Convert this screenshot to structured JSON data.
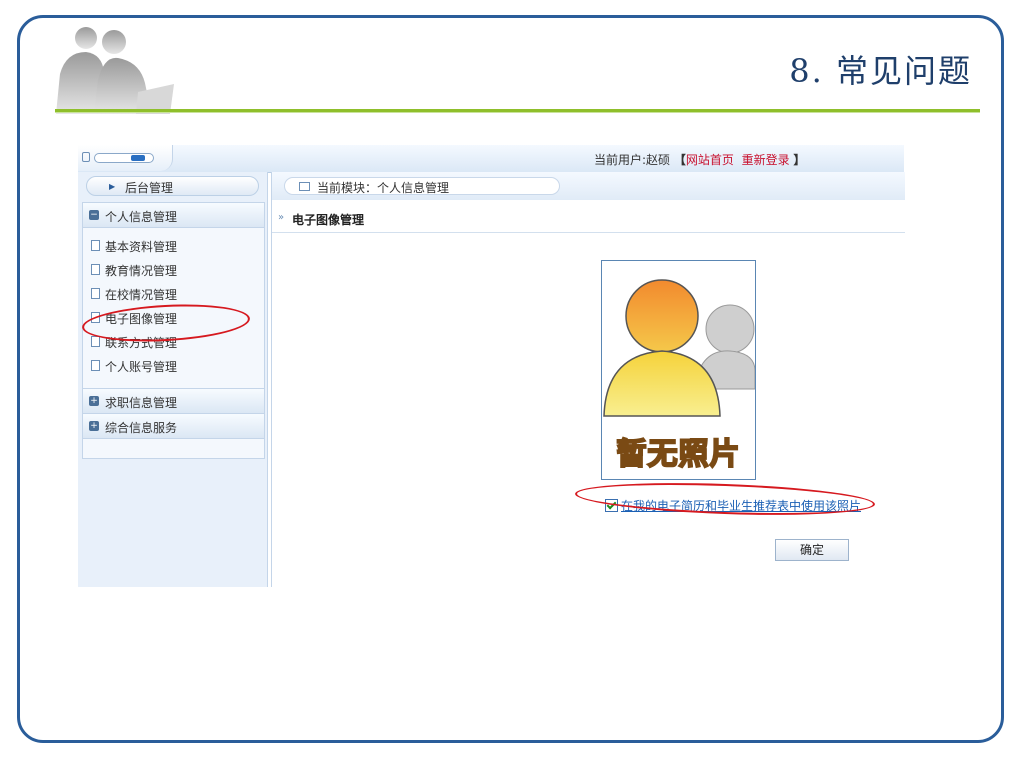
{
  "slide": {
    "title": "8. 常见问题",
    "colors": {
      "frame": "#2a5d9a",
      "rule": "#8fbf2b",
      "highlight": "#d6191f"
    }
  },
  "header": {
    "current_user_label": "当前用户:",
    "user_name": "赵硕",
    "bracket_open": "【",
    "site_home": "网站首页",
    "relogin": "重新登录",
    "bracket_close": "】"
  },
  "sidebar": {
    "header_label": "后台管理",
    "groups": [
      {
        "label": "个人信息管理",
        "expanded": true,
        "items": [
          {
            "label": "基本资料管理"
          },
          {
            "label": "教育情况管理"
          },
          {
            "label": "在校情况管理"
          },
          {
            "label": "电子图像管理"
          },
          {
            "label": "联系方式管理"
          },
          {
            "label": "个人账号管理"
          }
        ]
      },
      {
        "label": "求职信息管理",
        "expanded": false
      },
      {
        "label": "综合信息服务",
        "expanded": false
      }
    ]
  },
  "main": {
    "breadcrumb": "当前模块：个人信息管理",
    "section_title": "电子图像管理",
    "photo_placeholder_text": "暂无照片",
    "use_photo_checkbox": {
      "label": "在我的电子简历和毕业生推荐表中使用该照片",
      "checked": true
    },
    "confirm_button": "确定"
  }
}
